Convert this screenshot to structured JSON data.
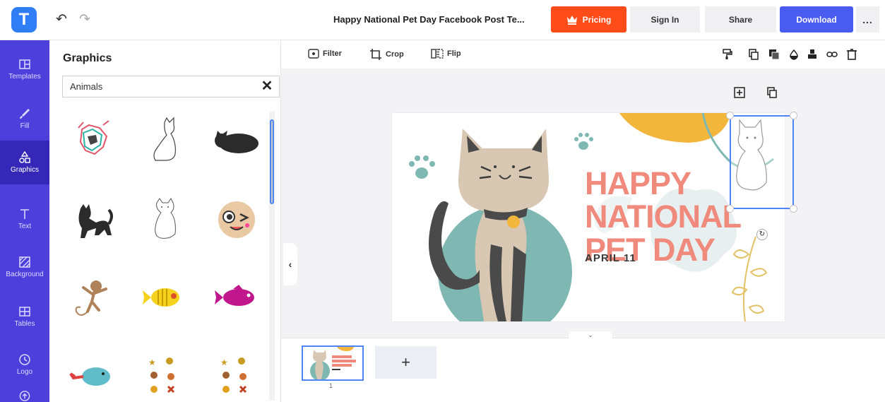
{
  "app": {
    "logo_letter": "T",
    "accent": "#4c3fdc"
  },
  "header": {
    "title": "Happy National Pet Day Facebook Post Te...",
    "pricing_label": "Pricing",
    "signin_label": "Sign In",
    "share_label": "Share",
    "download_label": "Download",
    "more_label": "...",
    "colors": {
      "pricing": "#ff4d1a",
      "download": "#4a5bf0"
    }
  },
  "sidebar": {
    "items": [
      {
        "label": "Templates",
        "icon": "templates-icon"
      },
      {
        "label": "Fill",
        "icon": "brush-icon"
      },
      {
        "label": "Graphics",
        "icon": "shapes-icon"
      },
      {
        "label": "Text",
        "icon": "text-icon"
      },
      {
        "label": "Background",
        "icon": "background-icon"
      },
      {
        "label": "Tables",
        "icon": "table-icon"
      },
      {
        "label": "Logo",
        "icon": "logo-icon"
      }
    ],
    "active": "Graphics"
  },
  "panel": {
    "title": "Graphics",
    "search_value": "Animals",
    "graphics": [
      "colorful-dog",
      "cat-outline-sitting",
      "black-cat-sleeping",
      "black-cat-stretching",
      "cat-outline-white",
      "monkey-face-winking",
      "monkey-swinging",
      "yellow-fish",
      "pink-fish",
      "blue-whale",
      "pets-sticker-set",
      "pets-sticker-set-2"
    ]
  },
  "toolbar": {
    "filter_label": "Filter",
    "crop_label": "Crop",
    "flip_label": "Flip",
    "right_icons": [
      "paint-format-icon",
      "copy-icon",
      "layer-icon",
      "opacity-icon",
      "align-icon",
      "link-icon",
      "delete-icon"
    ],
    "float_icons": [
      "duplicate-plus-icon",
      "copy-icon"
    ]
  },
  "design": {
    "headline_lines": [
      "HAPPY",
      "NATIONAL",
      "PET DAY"
    ],
    "date": "APRIL 11",
    "colors": {
      "headline": "#ef8a7d",
      "sun": "#f2b63c",
      "teal": "#7fb8b3"
    }
  },
  "pages": {
    "page_number": "1",
    "add_label": "+"
  }
}
